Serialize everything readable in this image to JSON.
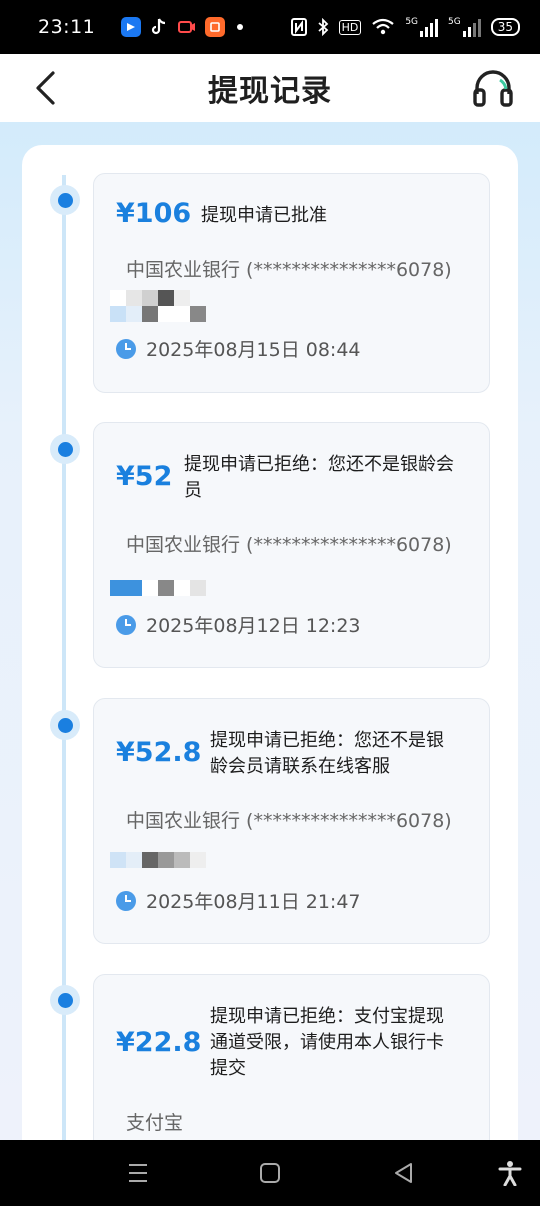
{
  "status_bar": {
    "time": "23:11",
    "network_label": "5G",
    "hd_label": "HD",
    "battery": "35"
  },
  "header": {
    "title": "提现记录"
  },
  "records": [
    {
      "amount": "¥106",
      "status": "提现申请已批准",
      "bank": "中国农业银行 (***************6078)",
      "time": "2025年08月15日 08:44"
    },
    {
      "amount": "¥52",
      "status": "提现申请已拒绝：您还不是银龄会员",
      "bank": "中国农业银行 (***************6078)",
      "time": "2025年08月12日 12:23"
    },
    {
      "amount": "¥52.8",
      "status": "提现申请已拒绝：您还不是银龄会员请联系在线客服",
      "bank": "中国农业银行 (***************6078)",
      "time": "2025年08月11日 21:47"
    },
    {
      "amount": "¥22.8",
      "status": "提现申请已拒绝：支付宝提现通道受限，请使用本人银行卡提交",
      "bank": "支付宝"
    }
  ],
  "colors": {
    "accent": "#1a80de",
    "timeline": "#cde6f8"
  }
}
